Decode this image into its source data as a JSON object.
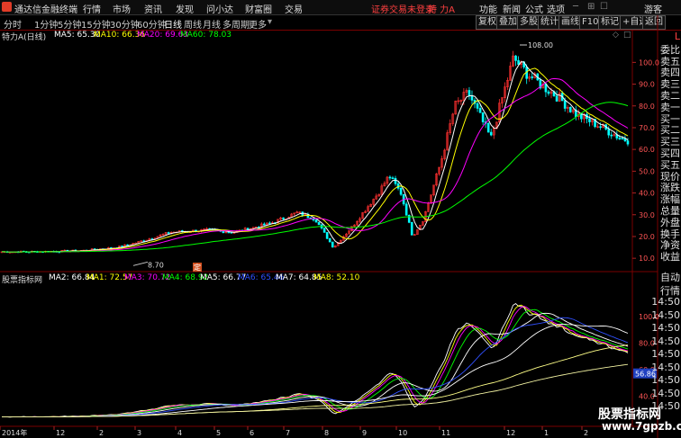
{
  "app": {
    "name": "通达信金融终端",
    "login_status": "证券交易未登录",
    "stock_badge": "特 力A"
  },
  "menu": [
    "行情",
    "市场",
    "资讯",
    "发现",
    "问小达",
    "财富圈",
    "交易"
  ],
  "menu_right": [
    "功能",
    "新闻",
    "公式",
    "选项"
  ],
  "user": "游客",
  "periods": [
    "分时",
    "1分钟",
    "5分钟",
    "15分钟",
    "30分钟",
    "60分钟",
    "日线",
    "周线",
    "月线",
    "多周期",
    "更多"
  ],
  "tools": [
    "复权",
    "叠加",
    "多股",
    "统计",
    "画线",
    "F10",
    "标记",
    "+自选",
    "返回"
  ],
  "main_chart": {
    "name": "特力A(日线)",
    "ma": [
      {
        "label": "MA5: 65.30",
        "color": "#ffffff"
      },
      {
        "label": "MA10: 66.36",
        "color": "#ffff00"
      },
      {
        "label": "MA20: 69.63",
        "color": "#ff00ff"
      },
      {
        "label": "MA60: 78.03",
        "color": "#00ff00"
      }
    ],
    "y_ticks": [
      "100.0",
      "90.0",
      "80.0",
      "70.0",
      "60.0",
      "50.0",
      "40.0",
      "30.0",
      "20.0",
      "10.0"
    ],
    "high_label": "108.00",
    "low_label": "8.70",
    "marker": "定"
  },
  "indicator": {
    "name": "股票指标网",
    "ma": [
      {
        "label": "MA2: 66.84",
        "color": "#ffffff"
      },
      {
        "label": "MA1: 72.57",
        "color": "#ffff00"
      },
      {
        "label": "MA3: 70.72",
        "color": "#ff00ff"
      },
      {
        "label": "MA4: 68.92",
        "color": "#00ff00"
      },
      {
        "label": "MA5: 66.77",
        "color": "#ffffff"
      },
      {
        "label": "MA6: 65.46",
        "color": "#0000ff"
      },
      {
        "label": "MA7: 64.85",
        "color": "#ffffff"
      },
      {
        "label": "MA8: 52.10",
        "color": "#ffff00"
      }
    ],
    "y_ticks": [
      "100.0",
      "80.0",
      "60.0",
      "40.0"
    ],
    "current_value": "56.86"
  },
  "x_axis": [
    "2014年",
    "12",
    "2",
    "3",
    "4",
    "5",
    "6",
    "7",
    "8",
    "9",
    "10",
    "11",
    "12",
    "1",
    "2"
  ],
  "side_top": [
    "L",
    "委比",
    "卖五",
    "卖四",
    "卖三",
    "卖二",
    "卖一",
    "买一",
    "买二",
    "买三",
    "买四",
    "买五",
    "现价",
    "涨跌",
    "涨幅",
    "总量",
    "外盘",
    "换手",
    "净资",
    "收益"
  ],
  "side_bottom": [
    "自动",
    "行情",
    "14:50",
    "14:50",
    "14:50",
    "14:50",
    "14:50",
    "14:50",
    "14:50",
    "14:50",
    "14:50"
  ],
  "watermark": {
    "line1": "股票指标网",
    "line2": "www.7gpzb.com"
  },
  "colors": {
    "up": "#ff3030",
    "down": "#00ffff",
    "background": "#000000",
    "grid": "#7a0000"
  }
}
